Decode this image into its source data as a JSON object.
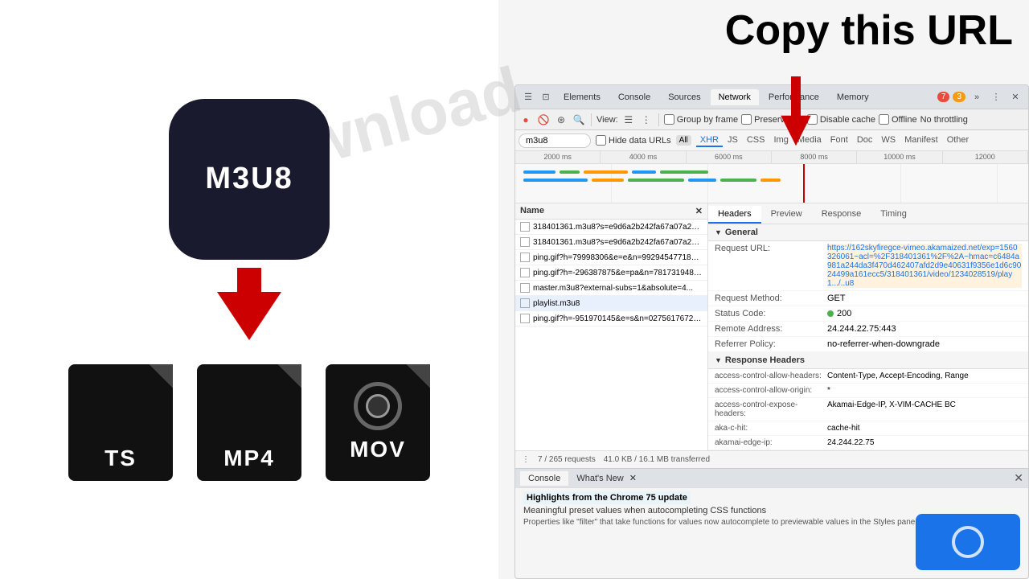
{
  "page": {
    "background": "#ffffff"
  },
  "left": {
    "m3u8_label": "M3U8",
    "download_watermark": "Download",
    "file_types": [
      "TS",
      "MP4",
      "MOV"
    ]
  },
  "right": {
    "copy_url_header": "Copy this URL",
    "devtools": {
      "tabs": [
        "Elements",
        "Console",
        "Sources",
        "Network",
        "Performance",
        "Memory"
      ],
      "active_tab": "Network",
      "badges": {
        "red": "7",
        "yellow": "3"
      },
      "toolbar": {
        "view_label": "View:",
        "group_by_frame": "Group by frame",
        "preserve_log": "Preserve log",
        "disable_cache": "Disable cache",
        "offline": "Offline",
        "no_throttling": "No throttling"
      },
      "filter": {
        "placeholder": "m3u8",
        "hide_data_urls": "Hide data URLs",
        "tabs": [
          "XHR",
          "JS",
          "CSS",
          "Img",
          "Media",
          "Font",
          "Doc",
          "WS",
          "Manifest",
          "Other"
        ]
      },
      "timeline": {
        "marks": [
          "2000 ms",
          "4000 ms",
          "6000 ms",
          "8000 ms",
          "10000 ms",
          "12000"
        ]
      },
      "requests": [
        {
          "name": "318401361.m3u8?s=e9d6a2b242fa67a07a2af56...",
          "selected": false
        },
        {
          "name": "318401361.m3u8?s=e9d6a2b242fa67a07a2af56...",
          "selected": false
        },
        {
          "name": "ping.gif?h=79998306&e=e&n=99294547718322...",
          "selected": false
        },
        {
          "name": "ping.gif?h=-296387875&e=pa&n=781731948729...",
          "selected": false
        },
        {
          "name": "master.m3u8?external-subs=1&absolute=4...",
          "selected": false
        },
        {
          "name": "playlist.m3u8",
          "selected": true
        },
        {
          "name": "ping.gif?h=-951970145&e=s&n=0275617672119...",
          "selected": false
        }
      ],
      "detail": {
        "tabs": [
          "Headers",
          "Preview",
          "Response",
          "Timing"
        ],
        "active_tab": "Headers",
        "general": {
          "title": "General",
          "request_url": "https://162skyfiregce-vimeo.akamaized.net/exp=1560326061~acl=%2F318401361%2F%2A~hmac=c6484a981a244da3f470d462407afd2d9e40631f9356e1d6c9024499a161ecc5/318401361/video/1234028519/play1.../..u8",
          "request_method": "GET",
          "status_code": "200",
          "remote_address": "24.244.22.75:443",
          "referrer_policy": "no-referrer-when-downgrade"
        },
        "response_headers": {
          "title": "Response Headers",
          "access_control_allow_headers": "Content-Type, Accept-Encoding, Range",
          "access_control_allow_origin": "*",
          "access_control_expose_headers": "Akamai-Edge-IP, X-VIM-CACHE BC",
          "aka_c_hit": "cache-hit",
          "akamai_edge_ip": "24.244.22.75"
        }
      },
      "status_bar": {
        "requests": "7 / 265 requests",
        "transferred": "41.0 KB / 16.1 MB transferred"
      },
      "console": {
        "tabs": [
          "Console",
          "What's New"
        ],
        "highlight": "Highlights from the Chrome 75 update",
        "text": "Meaningful preset values when autocompleting CSS functions",
        "subtext": "Properties like \"filter\" that take functions for values now autocomplete to previewable values in the Styles pane."
      }
    }
  }
}
